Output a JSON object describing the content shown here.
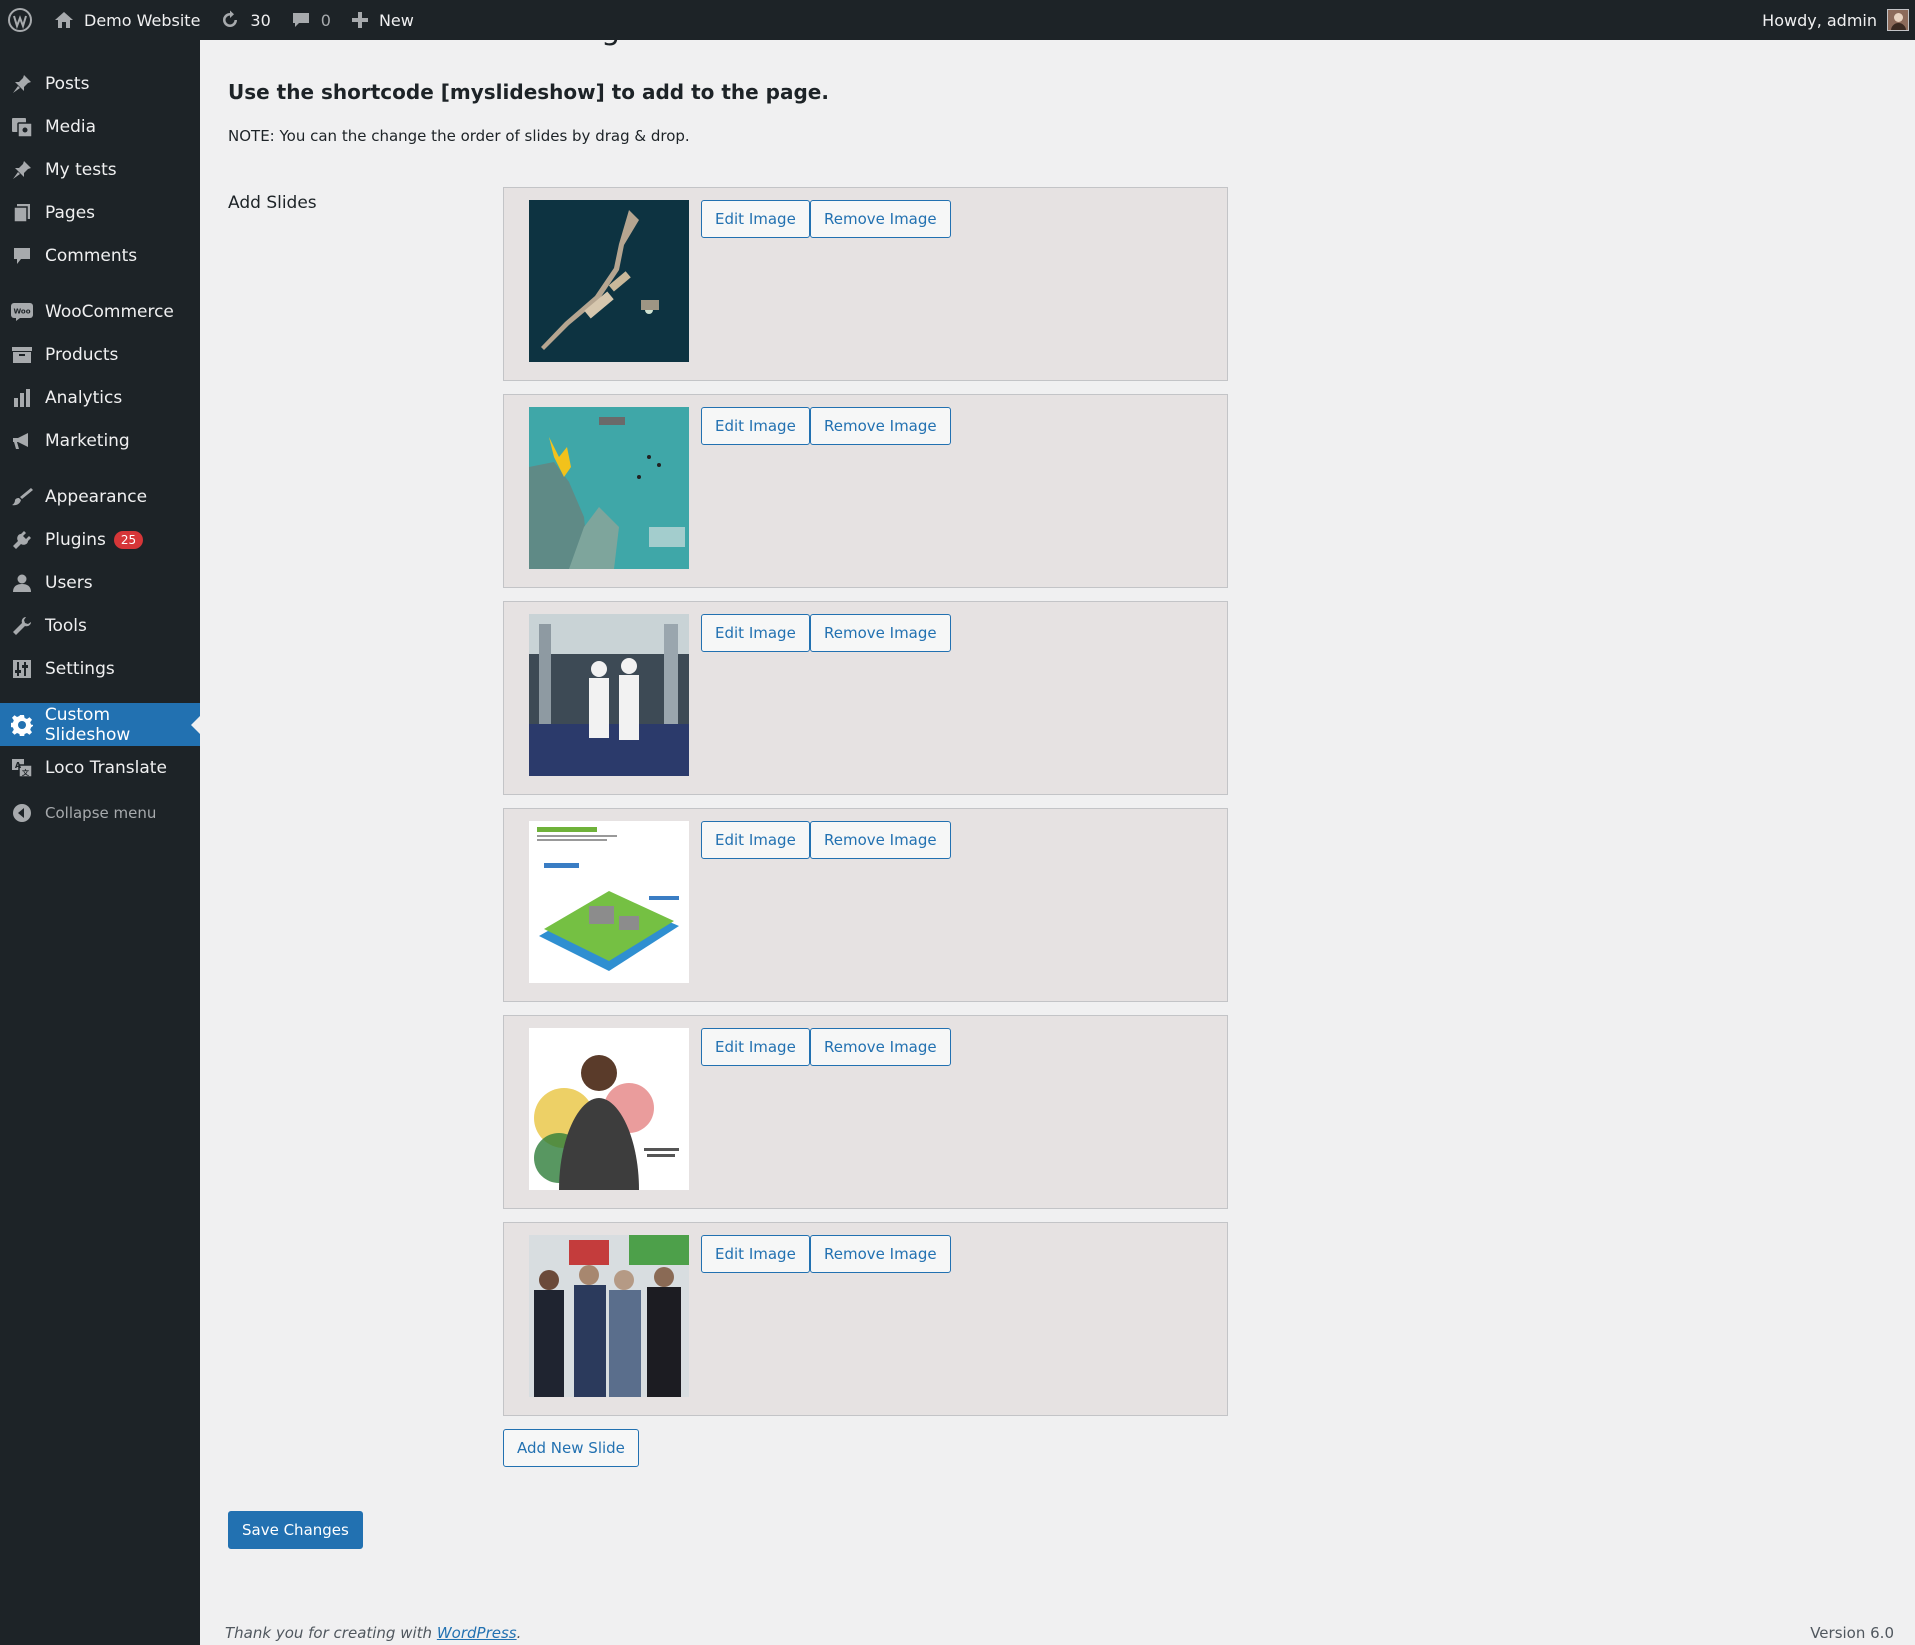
{
  "adminbar": {
    "site_name": "Demo Website",
    "updates_count": "30",
    "comments_count": "0",
    "new_label": "New",
    "greeting": "Howdy, admin"
  },
  "sidebar": {
    "items": [
      {
        "label": "Posts",
        "icon": "pin-icon"
      },
      {
        "label": "Media",
        "icon": "media-icon"
      },
      {
        "label": "My tests",
        "icon": "pin-icon"
      },
      {
        "label": "Pages",
        "icon": "page-icon"
      },
      {
        "label": "Comments",
        "icon": "comment-icon"
      },
      {
        "label": "WooCommerce",
        "icon": "woo-icon"
      },
      {
        "label": "Products",
        "icon": "archive-icon"
      },
      {
        "label": "Analytics",
        "icon": "bar-chart-icon"
      },
      {
        "label": "Marketing",
        "icon": "megaphone-icon"
      },
      {
        "label": "Appearance",
        "icon": "brush-icon"
      },
      {
        "label": "Plugins",
        "icon": "plug-icon",
        "badge": "25"
      },
      {
        "label": "Users",
        "icon": "user-icon"
      },
      {
        "label": "Tools",
        "icon": "wrench-icon"
      },
      {
        "label": "Settings",
        "icon": "sliders-icon"
      },
      {
        "label": "Custom Slideshow",
        "icon": "gear-icon"
      },
      {
        "label": "Loco Translate",
        "icon": "translate-icon"
      }
    ],
    "collapse_label": "Collapse menu",
    "accent": "#2271b1"
  },
  "main": {
    "page_title": "Custom Slideshow Settings",
    "shortcode_text": "Use the shortcode [myslideshow] to add to the page.",
    "note": "NOTE: You can the change the order of slides by drag & drop.",
    "add_slides_label": "Add Slides",
    "slides": [
      {
        "edit_label": "Edit Image",
        "remove_label": "Remove Image"
      },
      {
        "edit_label": "Edit Image",
        "remove_label": "Remove Image"
      },
      {
        "edit_label": "Edit Image",
        "remove_label": "Remove Image"
      },
      {
        "edit_label": "Edit Image",
        "remove_label": "Remove Image"
      },
      {
        "edit_label": "Edit Image",
        "remove_label": "Remove Image"
      },
      {
        "edit_label": "Edit Image",
        "remove_label": "Remove Image"
      }
    ],
    "add_new_slide_label": "Add New Slide",
    "save_label": "Save Changes"
  },
  "footer": {
    "thanks_prefix": "Thank you for creating with ",
    "thanks_link": "WordPress",
    "thanks_suffix": ".",
    "version": "Version 6.0"
  }
}
